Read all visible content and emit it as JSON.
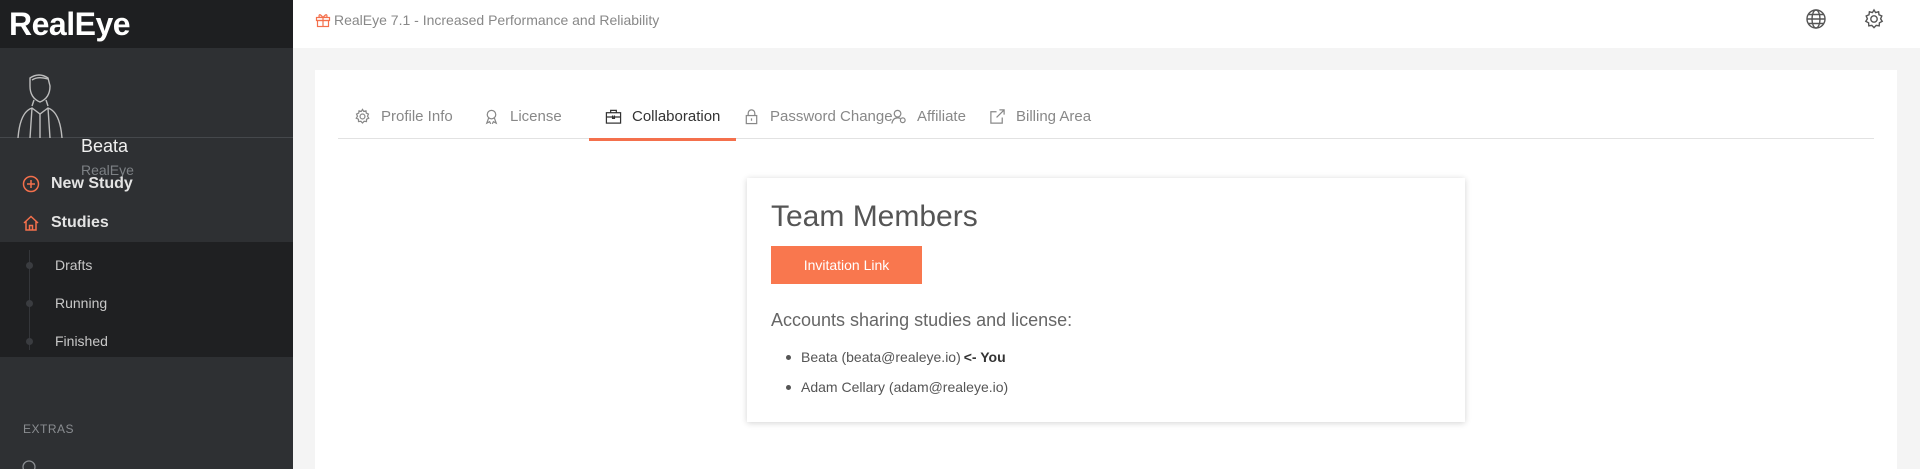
{
  "brand": {
    "name": "RealEye"
  },
  "user": {
    "name": "Beata",
    "org": "RealEye"
  },
  "nav": {
    "main": [
      {
        "label": "New Study",
        "icon": "plus-circle-icon"
      },
      {
        "label": "Studies",
        "icon": "home-icon"
      }
    ],
    "sub": [
      {
        "label": "Drafts"
      },
      {
        "label": "Running"
      },
      {
        "label": "Finished"
      }
    ],
    "section_label": "EXTRAS"
  },
  "topbar": {
    "announcement": "RealEye 7.1 - Increased Performance and Reliability",
    "icons": [
      "globe-icon",
      "gear-icon"
    ]
  },
  "tabs": [
    {
      "label": "Profile Info",
      "icon": "gear-icon",
      "active": false
    },
    {
      "label": "License",
      "icon": "award-icon",
      "active": false
    },
    {
      "label": "Collaboration",
      "icon": "briefcase-icon",
      "active": true
    },
    {
      "label": "Password Change",
      "icon": "lock-icon",
      "active": false
    },
    {
      "label": "Affiliate",
      "icon": "user-badge-icon",
      "active": false
    },
    {
      "label": "Billing Area",
      "icon": "external-link-icon",
      "active": false
    }
  ],
  "team": {
    "title": "Team Members",
    "invite_button": "Invitation Link",
    "accounts_heading": "Accounts sharing studies and license:",
    "members": [
      {
        "text": "Beata (beata@realeye.io)",
        "you": "<- You"
      },
      {
        "text": "Adam Cellary (adam@realeye.io)",
        "you": ""
      }
    ]
  },
  "colors": {
    "accent": "#f4704c",
    "button": "#f9774e",
    "sidebar": "#2e3033",
    "sidebar_dark": "#1e1f21"
  }
}
